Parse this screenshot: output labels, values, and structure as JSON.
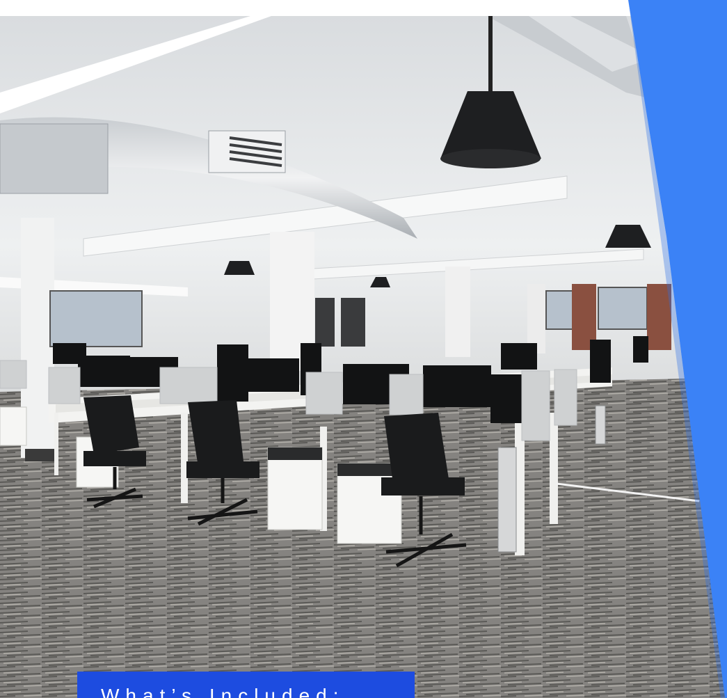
{
  "hero": {
    "image_description_icon": "office-photo",
    "accent_color": "#3b82f6"
  },
  "caption": {
    "label": "What’s Included:",
    "background": "#1d4ce0"
  }
}
